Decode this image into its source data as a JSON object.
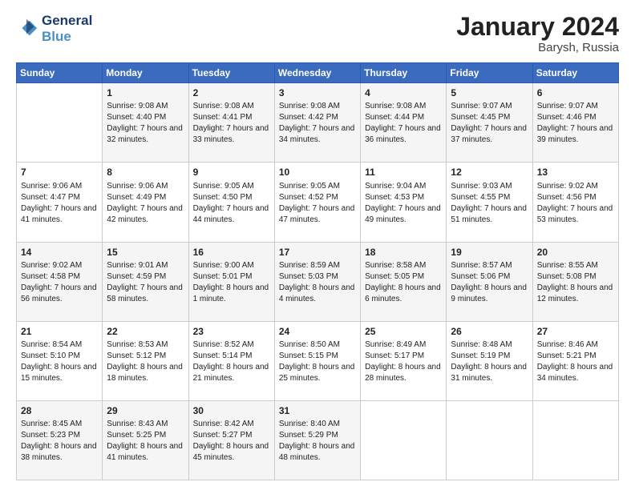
{
  "header": {
    "logo_line1": "General",
    "logo_line2": "Blue",
    "month": "January 2024",
    "location": "Barysh, Russia"
  },
  "days_of_week": [
    "Sunday",
    "Monday",
    "Tuesday",
    "Wednesday",
    "Thursday",
    "Friday",
    "Saturday"
  ],
  "weeks": [
    [
      {
        "day": "",
        "sunrise": "",
        "sunset": "",
        "daylight": ""
      },
      {
        "day": "1",
        "sunrise": "Sunrise: 9:08 AM",
        "sunset": "Sunset: 4:40 PM",
        "daylight": "Daylight: 7 hours and 32 minutes."
      },
      {
        "day": "2",
        "sunrise": "Sunrise: 9:08 AM",
        "sunset": "Sunset: 4:41 PM",
        "daylight": "Daylight: 7 hours and 33 minutes."
      },
      {
        "day": "3",
        "sunrise": "Sunrise: 9:08 AM",
        "sunset": "Sunset: 4:42 PM",
        "daylight": "Daylight: 7 hours and 34 minutes."
      },
      {
        "day": "4",
        "sunrise": "Sunrise: 9:08 AM",
        "sunset": "Sunset: 4:44 PM",
        "daylight": "Daylight: 7 hours and 36 minutes."
      },
      {
        "day": "5",
        "sunrise": "Sunrise: 9:07 AM",
        "sunset": "Sunset: 4:45 PM",
        "daylight": "Daylight: 7 hours and 37 minutes."
      },
      {
        "day": "6",
        "sunrise": "Sunrise: 9:07 AM",
        "sunset": "Sunset: 4:46 PM",
        "daylight": "Daylight: 7 hours and 39 minutes."
      }
    ],
    [
      {
        "day": "7",
        "sunrise": "Sunrise: 9:06 AM",
        "sunset": "Sunset: 4:47 PM",
        "daylight": "Daylight: 7 hours and 41 minutes."
      },
      {
        "day": "8",
        "sunrise": "Sunrise: 9:06 AM",
        "sunset": "Sunset: 4:49 PM",
        "daylight": "Daylight: 7 hours and 42 minutes."
      },
      {
        "day": "9",
        "sunrise": "Sunrise: 9:05 AM",
        "sunset": "Sunset: 4:50 PM",
        "daylight": "Daylight: 7 hours and 44 minutes."
      },
      {
        "day": "10",
        "sunrise": "Sunrise: 9:05 AM",
        "sunset": "Sunset: 4:52 PM",
        "daylight": "Daylight: 7 hours and 47 minutes."
      },
      {
        "day": "11",
        "sunrise": "Sunrise: 9:04 AM",
        "sunset": "Sunset: 4:53 PM",
        "daylight": "Daylight: 7 hours and 49 minutes."
      },
      {
        "day": "12",
        "sunrise": "Sunrise: 9:03 AM",
        "sunset": "Sunset: 4:55 PM",
        "daylight": "Daylight: 7 hours and 51 minutes."
      },
      {
        "day": "13",
        "sunrise": "Sunrise: 9:02 AM",
        "sunset": "Sunset: 4:56 PM",
        "daylight": "Daylight: 7 hours and 53 minutes."
      }
    ],
    [
      {
        "day": "14",
        "sunrise": "Sunrise: 9:02 AM",
        "sunset": "Sunset: 4:58 PM",
        "daylight": "Daylight: 7 hours and 56 minutes."
      },
      {
        "day": "15",
        "sunrise": "Sunrise: 9:01 AM",
        "sunset": "Sunset: 4:59 PM",
        "daylight": "Daylight: 7 hours and 58 minutes."
      },
      {
        "day": "16",
        "sunrise": "Sunrise: 9:00 AM",
        "sunset": "Sunset: 5:01 PM",
        "daylight": "Daylight: 8 hours and 1 minute."
      },
      {
        "day": "17",
        "sunrise": "Sunrise: 8:59 AM",
        "sunset": "Sunset: 5:03 PM",
        "daylight": "Daylight: 8 hours and 4 minutes."
      },
      {
        "day": "18",
        "sunrise": "Sunrise: 8:58 AM",
        "sunset": "Sunset: 5:05 PM",
        "daylight": "Daylight: 8 hours and 6 minutes."
      },
      {
        "day": "19",
        "sunrise": "Sunrise: 8:57 AM",
        "sunset": "Sunset: 5:06 PM",
        "daylight": "Daylight: 8 hours and 9 minutes."
      },
      {
        "day": "20",
        "sunrise": "Sunrise: 8:55 AM",
        "sunset": "Sunset: 5:08 PM",
        "daylight": "Daylight: 8 hours and 12 minutes."
      }
    ],
    [
      {
        "day": "21",
        "sunrise": "Sunrise: 8:54 AM",
        "sunset": "Sunset: 5:10 PM",
        "daylight": "Daylight: 8 hours and 15 minutes."
      },
      {
        "day": "22",
        "sunrise": "Sunrise: 8:53 AM",
        "sunset": "Sunset: 5:12 PM",
        "daylight": "Daylight: 8 hours and 18 minutes."
      },
      {
        "day": "23",
        "sunrise": "Sunrise: 8:52 AM",
        "sunset": "Sunset: 5:14 PM",
        "daylight": "Daylight: 8 hours and 21 minutes."
      },
      {
        "day": "24",
        "sunrise": "Sunrise: 8:50 AM",
        "sunset": "Sunset: 5:15 PM",
        "daylight": "Daylight: 8 hours and 25 minutes."
      },
      {
        "day": "25",
        "sunrise": "Sunrise: 8:49 AM",
        "sunset": "Sunset: 5:17 PM",
        "daylight": "Daylight: 8 hours and 28 minutes."
      },
      {
        "day": "26",
        "sunrise": "Sunrise: 8:48 AM",
        "sunset": "Sunset: 5:19 PM",
        "daylight": "Daylight: 8 hours and 31 minutes."
      },
      {
        "day": "27",
        "sunrise": "Sunrise: 8:46 AM",
        "sunset": "Sunset: 5:21 PM",
        "daylight": "Daylight: 8 hours and 34 minutes."
      }
    ],
    [
      {
        "day": "28",
        "sunrise": "Sunrise: 8:45 AM",
        "sunset": "Sunset: 5:23 PM",
        "daylight": "Daylight: 8 hours and 38 minutes."
      },
      {
        "day": "29",
        "sunrise": "Sunrise: 8:43 AM",
        "sunset": "Sunset: 5:25 PM",
        "daylight": "Daylight: 8 hours and 41 minutes."
      },
      {
        "day": "30",
        "sunrise": "Sunrise: 8:42 AM",
        "sunset": "Sunset: 5:27 PM",
        "daylight": "Daylight: 8 hours and 45 minutes."
      },
      {
        "day": "31",
        "sunrise": "Sunrise: 8:40 AM",
        "sunset": "Sunset: 5:29 PM",
        "daylight": "Daylight: 8 hours and 48 minutes."
      },
      {
        "day": "",
        "sunrise": "",
        "sunset": "",
        "daylight": ""
      },
      {
        "day": "",
        "sunrise": "",
        "sunset": "",
        "daylight": ""
      },
      {
        "day": "",
        "sunrise": "",
        "sunset": "",
        "daylight": ""
      }
    ]
  ]
}
